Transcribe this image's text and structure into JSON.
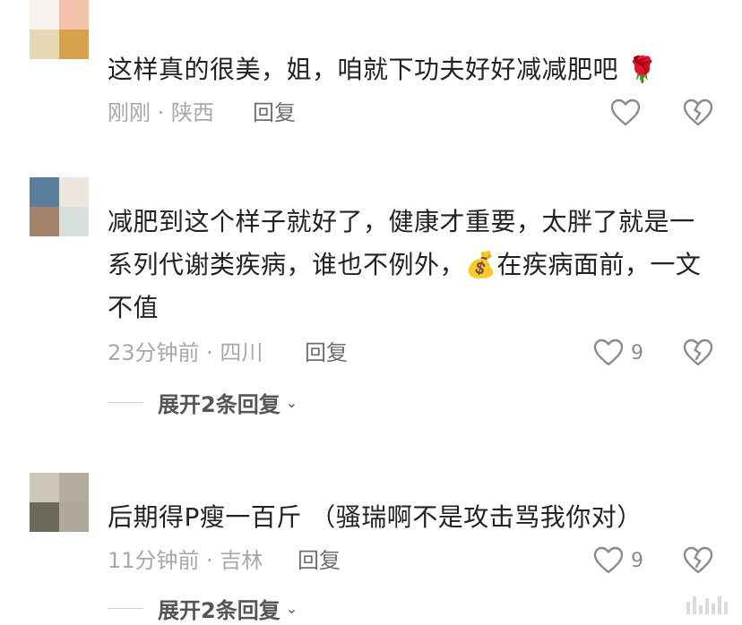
{
  "comments": [
    {
      "text": "这样真的很美，姐，咱就下功夫好好减减肥吧 🌹",
      "meta": "刚刚 · 陕西",
      "reply_label": "回复",
      "likes": "",
      "avatar_colors": [
        "#f6f3ee",
        "#f2c3aa",
        "#e6d8b5",
        "#d6a24a"
      ]
    },
    {
      "text": "减肥到这个样子就好了，健康才重要，太胖了就是一系列代谢类疾病，谁也不例外，💰在疾病面前，一文不值",
      "meta": "23分钟前 · 四川",
      "reply_label": "回复",
      "likes": "9",
      "expand_label": "展开2条回复",
      "avatar_colors": [
        "#5a7d9b",
        "#ece6dd",
        "#a4826a",
        "#d6e0dc"
      ]
    },
    {
      "text": "后期得P瘦一百斤 （骚瑞啊不是攻击骂我你对）",
      "meta": "11分钟前 · 吉林",
      "reply_label": "回复",
      "likes": "9",
      "expand_label": "展开2条回复",
      "avatar_colors": [
        "#cdc7bb",
        "#b3aca1",
        "#6b6a5c",
        "#b0a89b"
      ]
    }
  ],
  "icons": {
    "like": "heart-outline-icon",
    "dislike": "broken-heart-icon",
    "expand": "chevron-down-icon"
  },
  "colors": {
    "text": "#222222",
    "meta": "#a8a8a8",
    "icon": "#8a8a8a"
  }
}
